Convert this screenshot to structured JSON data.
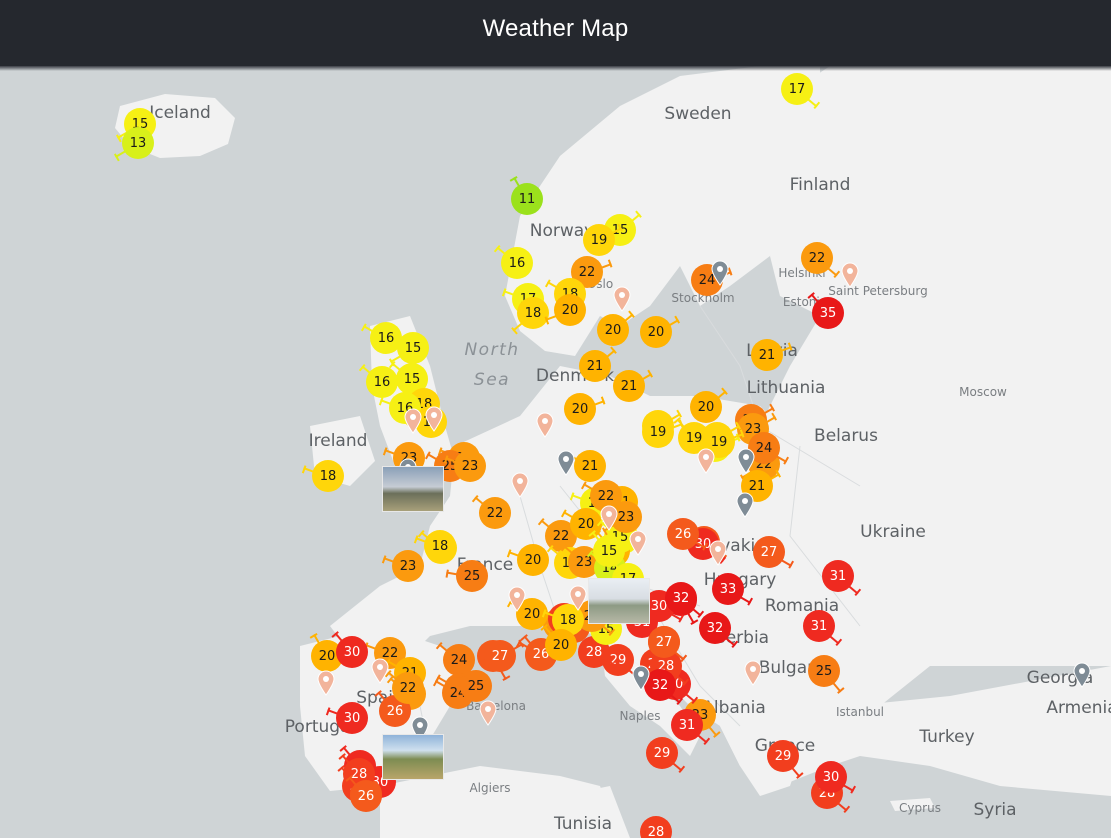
{
  "header": {
    "title": "Weather Map"
  },
  "colors": {
    "header_bg": "#25282e",
    "sea": "#cfd4d6",
    "land": "#f2f2f2"
  },
  "labels": {
    "countries": [
      "Iceland",
      "Sweden",
      "Finland",
      "Norway",
      "Denmark",
      "Ireland",
      "Belarus",
      "Ukraine",
      "France",
      "Romania",
      "Spain",
      "Turkey",
      "Greece",
      "Syria",
      "Tunisia",
      "Latvia",
      "Lithuania",
      "Portugal",
      "Albania",
      "Serbia",
      "Bulgaria",
      "Georgia",
      "Armenia",
      "Slovakia",
      "Hungary"
    ],
    "cities": [
      "Stockholm",
      "Helsinki",
      "Saint Petersburg",
      "Estonia",
      "Moscow",
      "Oslo",
      "Istanbul",
      "Algiers",
      "Cyprus",
      "Naples",
      "Barcelona"
    ],
    "sea": "North Sea"
  },
  "stations": [
    {
      "t": "15"
    },
    {
      "t": "13"
    },
    {
      "t": "17"
    },
    {
      "t": "11"
    },
    {
      "t": "15"
    },
    {
      "t": "19"
    },
    {
      "t": "16"
    },
    {
      "t": "22"
    },
    {
      "t": "17"
    },
    {
      "t": "18"
    },
    {
      "t": "18"
    },
    {
      "t": "20"
    },
    {
      "t": "24"
    },
    {
      "t": "22"
    },
    {
      "t": "35"
    },
    {
      "t": "20"
    },
    {
      "t": "20"
    },
    {
      "t": "16"
    },
    {
      "t": "15"
    },
    {
      "t": "21"
    },
    {
      "t": "21"
    },
    {
      "t": "21"
    },
    {
      "t": "15"
    },
    {
      "t": "16"
    },
    {
      "t": "18"
    },
    {
      "t": "16"
    },
    {
      "t": "20"
    },
    {
      "t": "24"
    },
    {
      "t": "23"
    },
    {
      "t": "19"
    },
    {
      "t": "17"
    },
    {
      "t": "18"
    },
    {
      "t": "19"
    },
    {
      "t": "18"
    },
    {
      "t": "22"
    },
    {
      "t": "24"
    },
    {
      "t": "21"
    },
    {
      "t": "23"
    },
    {
      "t": "25"
    },
    {
      "t": "18"
    },
    {
      "t": "23"
    },
    {
      "t": "25"
    },
    {
      "t": "22"
    },
    {
      "t": "20"
    },
    {
      "t": "22"
    },
    {
      "t": "27"
    },
    {
      "t": "26"
    },
    {
      "t": "31"
    },
    {
      "t": "33"
    },
    {
      "t": "32"
    },
    {
      "t": "31"
    },
    {
      "t": "25"
    },
    {
      "t": "30"
    },
    {
      "t": "29"
    },
    {
      "t": "27"
    },
    {
      "t": "29"
    },
    {
      "t": "26"
    },
    {
      "t": "29"
    },
    {
      "t": "28"
    },
    {
      "t": "30"
    },
    {
      "t": "32"
    },
    {
      "t": "31"
    },
    {
      "t": "23"
    },
    {
      "t": "29"
    },
    {
      "t": "28"
    },
    {
      "t": "29"
    },
    {
      "t": "31"
    },
    {
      "t": "30"
    },
    {
      "t": "20"
    },
    {
      "t": "22"
    },
    {
      "t": "21"
    },
    {
      "t": "22"
    },
    {
      "t": "26"
    },
    {
      "t": "30"
    },
    {
      "t": "30"
    },
    {
      "t": "28"
    },
    {
      "t": "26"
    },
    {
      "t": "24"
    },
    {
      "t": "27"
    },
    {
      "t": "25"
    },
    {
      "t": "26"
    },
    {
      "t": "20"
    },
    {
      "t": "16"
    },
    {
      "t": "21"
    },
    {
      "t": "22"
    },
    {
      "t": "17"
    },
    {
      "t": "19"
    },
    {
      "t": "20"
    },
    {
      "t": "18"
    },
    {
      "t": "19"
    },
    {
      "t": "15"
    },
    {
      "t": "22"
    },
    {
      "t": "23"
    },
    {
      "t": "20"
    },
    {
      "t": "23"
    },
    {
      "t": "30"
    },
    {
      "t": "28"
    },
    {
      "t": "27"
    },
    {
      "t": "26"
    },
    {
      "t": "30"
    },
    {
      "t": "32"
    },
    {
      "t": "22"
    },
    {
      "t": "18"
    },
    {
      "t": "22"
    },
    {
      "t": "20"
    },
    {
      "t": "15"
    },
    {
      "t": "14"
    },
    {
      "t": "21"
    },
    {
      "t": "23"
    },
    {
      "t": "23"
    },
    {
      "t": "30"
    },
    {
      "t": "28"
    },
    {
      "t": "26"
    },
    {
      "t": "24"
    },
    {
      "t": "27"
    },
    {
      "t": "15"
    },
    {
      "t": "17"
    },
    {
      "t": "18"
    },
    {
      "t": "19"
    },
    {
      "t": "32"
    },
    {
      "t": "20"
    },
    {
      "t": "25"
    },
    {
      "t": "26"
    },
    {
      "t": "28"
    }
  ],
  "cameras": [
    {
      "label": ""
    },
    {
      "label": ""
    },
    {
      "label": ""
    }
  ],
  "pins": 24
}
